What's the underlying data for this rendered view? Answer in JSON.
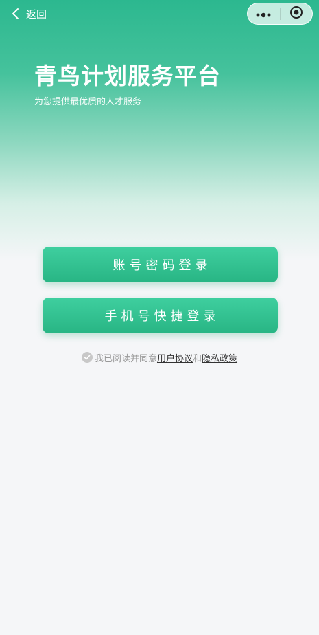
{
  "nav": {
    "back_label": "返回",
    "back_icon": "chevron-left-icon",
    "more_icon": "more-dots-icon",
    "close_icon": "target-circle-icon"
  },
  "hero": {
    "title": "青鸟计划服务平台",
    "subtitle": "为您提供最优质的人才服务"
  },
  "buttons": {
    "account_login": "账号密码登录",
    "phone_login": "手机号快捷登录"
  },
  "agreement": {
    "prefix": "我已阅读并同意",
    "user_agreement": "用户协议",
    "conjunction": "和",
    "privacy_policy": "隐私政策",
    "checkbox_icon": "check-circle-icon"
  },
  "colors": {
    "brand": "#2cb88f",
    "button": "#30bf8d",
    "background": "#f5f6f8"
  }
}
